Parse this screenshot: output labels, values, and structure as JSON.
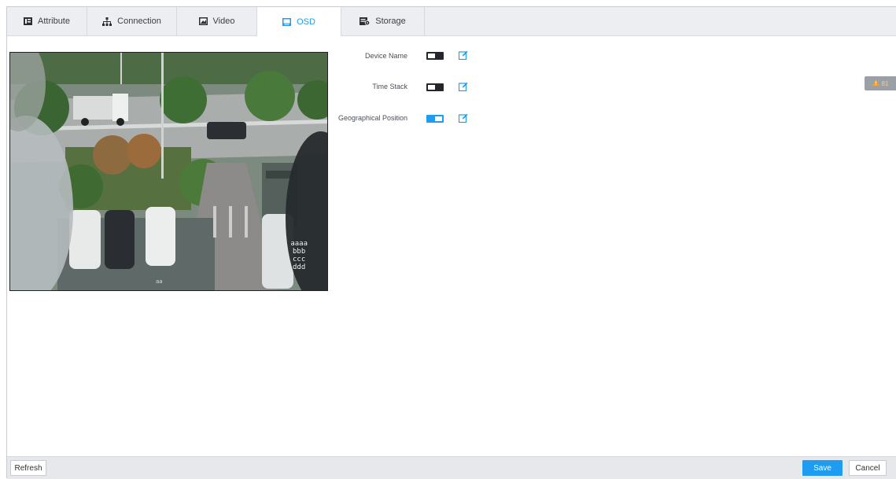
{
  "tabs": [
    {
      "label": "Attribute",
      "icon": "attribute-icon",
      "active": false
    },
    {
      "label": "Connection",
      "icon": "connection-icon",
      "active": false
    },
    {
      "label": "Video",
      "icon": "video-icon",
      "active": false
    },
    {
      "label": "OSD",
      "icon": "osd-icon",
      "active": true
    },
    {
      "label": "Storage",
      "icon": "storage-icon",
      "active": false
    }
  ],
  "preview": {
    "overlay_lines": [
      "aaaa",
      "bbb",
      "ccc",
      "ddd"
    ],
    "caption": "aa"
  },
  "osd": {
    "items": [
      {
        "label": "Device Name",
        "enabled": false
      },
      {
        "label": "Time Stack",
        "enabled": false
      },
      {
        "label": "Geographical Position",
        "enabled": true
      }
    ]
  },
  "alarm": {
    "icon": "warning-icon",
    "count": "81"
  },
  "footer": {
    "refresh_label": "Refresh",
    "save_label": "Save",
    "cancel_label": "Cancel"
  },
  "colors": {
    "accent": "#1e9cf0",
    "toggle_off": "#23272d",
    "tabbar_bg": "#eceef1",
    "footer_bg": "#e6e8eb",
    "badge_bg": "#9aa0a6"
  }
}
